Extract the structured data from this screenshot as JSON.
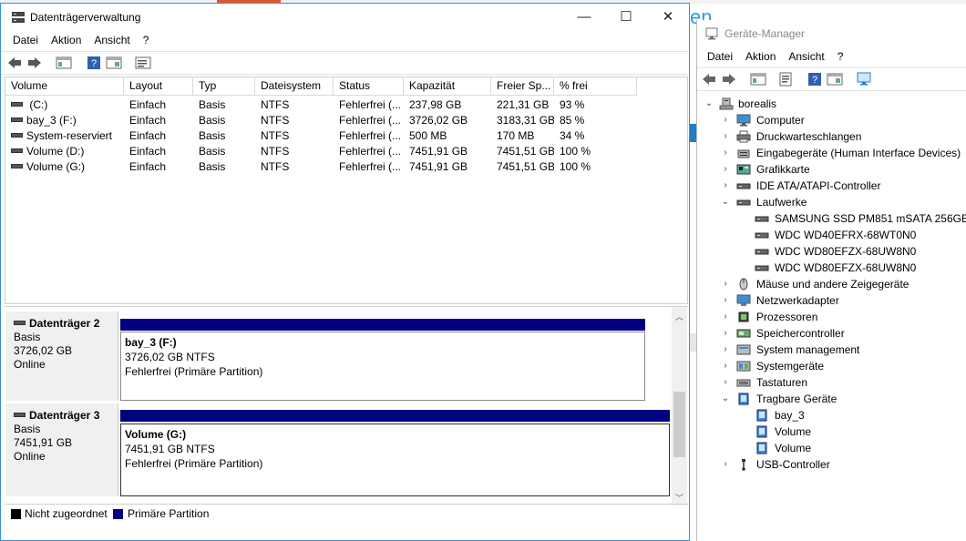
{
  "background": {
    "partial_text": "en"
  },
  "disk_management": {
    "title": "Datenträgerverwaltung",
    "window_controls": {
      "minimize": "—",
      "maximize": "☐",
      "close": "✕"
    },
    "menu": [
      "Datei",
      "Aktion",
      "Ansicht",
      "?"
    ],
    "columns": [
      "Volume",
      "Layout",
      "Typ",
      "Dateisystem",
      "Status",
      "Kapazität",
      "Freier Sp...",
      "% frei"
    ],
    "volumes": [
      {
        "volume": " (C:)",
        "layout": "Einfach",
        "typ": "Basis",
        "fs": "NTFS",
        "status": "Fehlerfrei (...",
        "capacity": "237,98 GB",
        "free": "221,31 GB",
        "pct": "93 %"
      },
      {
        "volume": "bay_3 (F:)",
        "layout": "Einfach",
        "typ": "Basis",
        "fs": "NTFS",
        "status": "Fehlerfrei (...",
        "capacity": "3726,02 GB",
        "free": "3183,31 GB",
        "pct": "85 %"
      },
      {
        "volume": "System-reserviert",
        "layout": "Einfach",
        "typ": "Basis",
        "fs": "NTFS",
        "status": "Fehlerfrei (...",
        "capacity": "500 MB",
        "free": "170 MB",
        "pct": "34 %"
      },
      {
        "volume": "Volume (D:)",
        "layout": "Einfach",
        "typ": "Basis",
        "fs": "NTFS",
        "status": "Fehlerfrei (...",
        "capacity": "7451,91 GB",
        "free": "7451,51 GB",
        "pct": "100 %"
      },
      {
        "volume": "Volume (G:)",
        "layout": "Einfach",
        "typ": "Basis",
        "fs": "NTFS",
        "status": "Fehlerfrei (...",
        "capacity": "7451,91 GB",
        "free": "7451,51 GB",
        "pct": "100 %"
      }
    ],
    "disks": [
      {
        "name": "Datenträger 2",
        "type": "Basis",
        "size": "3726,02 GB",
        "state": "Online",
        "partition": {
          "name": "bay_3  (F:)",
          "size": "3726,02 GB NTFS",
          "status": "Fehlerfrei (Primäre Partition)"
        }
      },
      {
        "name": "Datenträger 3",
        "type": "Basis",
        "size": "7451,91 GB",
        "state": "Online",
        "partition": {
          "name": "Volume  (G:)",
          "size": "7451,91 GB NTFS",
          "status": "Fehlerfrei (Primäre Partition)"
        }
      }
    ],
    "legend": [
      {
        "label": "Nicht zugeordnet",
        "color": "#000000"
      },
      {
        "label": "Primäre Partition",
        "color": "#000080"
      }
    ]
  },
  "device_manager": {
    "title": "Geräte-Manager",
    "menu": [
      "Datei",
      "Aktion",
      "Ansicht",
      "?"
    ],
    "root": "borealis",
    "tree": [
      {
        "label": "Computer",
        "level": 1,
        "expander": "›",
        "icon": "monitor-icon"
      },
      {
        "label": "Druckwarteschlangen",
        "level": 1,
        "expander": "›",
        "icon": "printer-icon"
      },
      {
        "label": "Eingabegeräte (Human Interface Devices)",
        "level": 1,
        "expander": "›",
        "icon": "hid-icon"
      },
      {
        "label": "Grafikkarte",
        "level": 1,
        "expander": "›",
        "icon": "display-adapter-icon"
      },
      {
        "label": "IDE ATA/ATAPI-Controller",
        "level": 1,
        "expander": "›",
        "icon": "ide-icon"
      },
      {
        "label": "Laufwerke",
        "level": 1,
        "expander": "⌄",
        "icon": "drive-icon"
      },
      {
        "label": "SAMSUNG SSD PM851 mSATA 256GB",
        "level": 2,
        "expander": "",
        "icon": "drive-icon"
      },
      {
        "label": "WDC WD40EFRX-68WT0N0",
        "level": 2,
        "expander": "",
        "icon": "drive-icon"
      },
      {
        "label": "WDC WD80EFZX-68UW8N0",
        "level": 2,
        "expander": "",
        "icon": "drive-icon"
      },
      {
        "label": "WDC WD80EFZX-68UW8N0",
        "level": 2,
        "expander": "",
        "icon": "drive-icon"
      },
      {
        "label": "Mäuse und andere Zeigegeräte",
        "level": 1,
        "expander": "›",
        "icon": "mouse-icon"
      },
      {
        "label": "Netzwerkadapter",
        "level": 1,
        "expander": "›",
        "icon": "network-icon"
      },
      {
        "label": "Prozessoren",
        "level": 1,
        "expander": "›",
        "icon": "processor-icon"
      },
      {
        "label": "Speichercontroller",
        "level": 1,
        "expander": "›",
        "icon": "storage-controller-icon"
      },
      {
        "label": "System management",
        "level": 1,
        "expander": "›",
        "icon": "system-management-icon"
      },
      {
        "label": "Systemgeräte",
        "level": 1,
        "expander": "›",
        "icon": "system-devices-icon"
      },
      {
        "label": "Tastaturen",
        "level": 1,
        "expander": "›",
        "icon": "keyboard-icon"
      },
      {
        "label": "Tragbare Geräte",
        "level": 1,
        "expander": "⌄",
        "icon": "portable-device-icon"
      },
      {
        "label": "bay_3",
        "level": 2,
        "expander": "",
        "icon": "portable-device-icon"
      },
      {
        "label": "Volume",
        "level": 2,
        "expander": "",
        "icon": "portable-device-icon"
      },
      {
        "label": "Volume",
        "level": 2,
        "expander": "",
        "icon": "portable-device-icon"
      },
      {
        "label": "USB-Controller",
        "level": 1,
        "expander": "›",
        "icon": "usb-icon"
      }
    ]
  }
}
